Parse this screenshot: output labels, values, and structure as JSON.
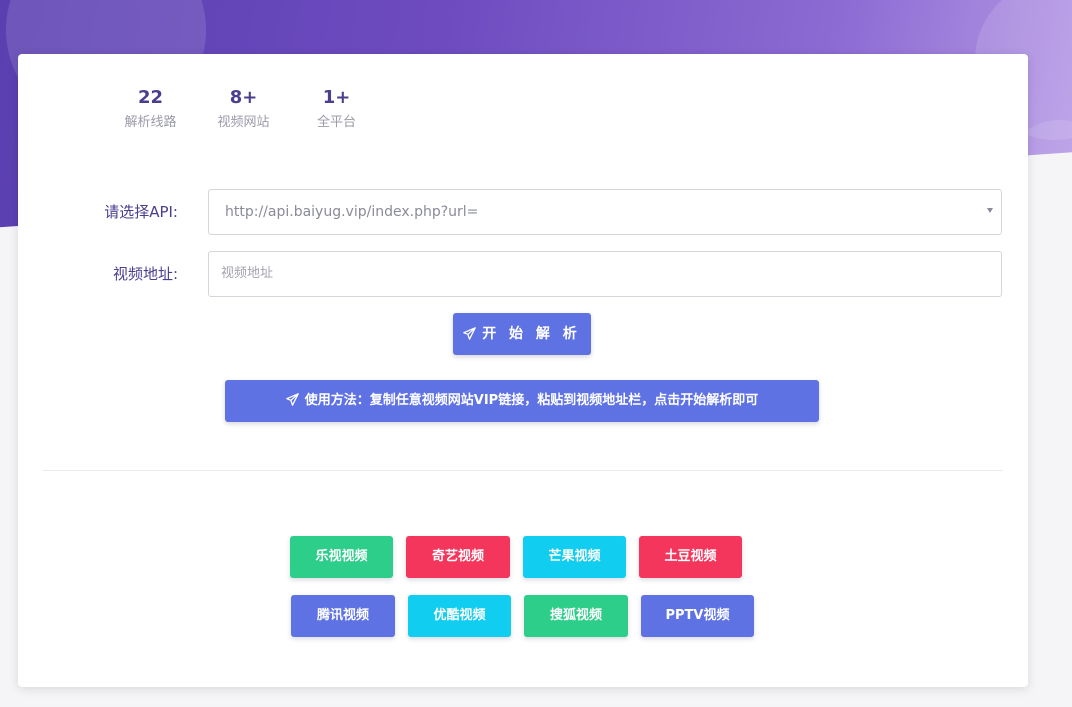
{
  "stats": [
    {
      "value": "22",
      "label": "解析线路"
    },
    {
      "value": "8+",
      "label": "视频网站"
    },
    {
      "value": "1+",
      "label": "全平台"
    }
  ],
  "form": {
    "api_label": "请选择API:",
    "api_selected": "http://api.baiyug.vip/index.php?url=",
    "url_label": "视频地址:",
    "url_placeholder": "视频地址",
    "url_value": ""
  },
  "actions": {
    "start_label": "开 始 解 析",
    "usage_tip": "使用方法：复制任意视频网站VIP链接，粘贴到视频地址栏，点击开始解析即可"
  },
  "sites": [
    {
      "label": "乐视视频",
      "color": "#2dce89"
    },
    {
      "label": "奇艺视频",
      "color": "#f5365c"
    },
    {
      "label": "芒果视频",
      "color": "#11cdef"
    },
    {
      "label": "土豆视频",
      "color": "#f5365c"
    },
    {
      "label": "腾讯视频",
      "color": "#5e72e4"
    },
    {
      "label": "优酷视频",
      "color": "#11cdef"
    },
    {
      "label": "搜狐视频",
      "color": "#2dce89"
    },
    {
      "label": "PPTV视频",
      "color": "#5e72e4"
    }
  ],
  "colors": {
    "primary": "#5e72e4",
    "success": "#2dce89",
    "danger": "#f5365c",
    "info": "#11cdef",
    "heading": "#4a3e8f"
  }
}
